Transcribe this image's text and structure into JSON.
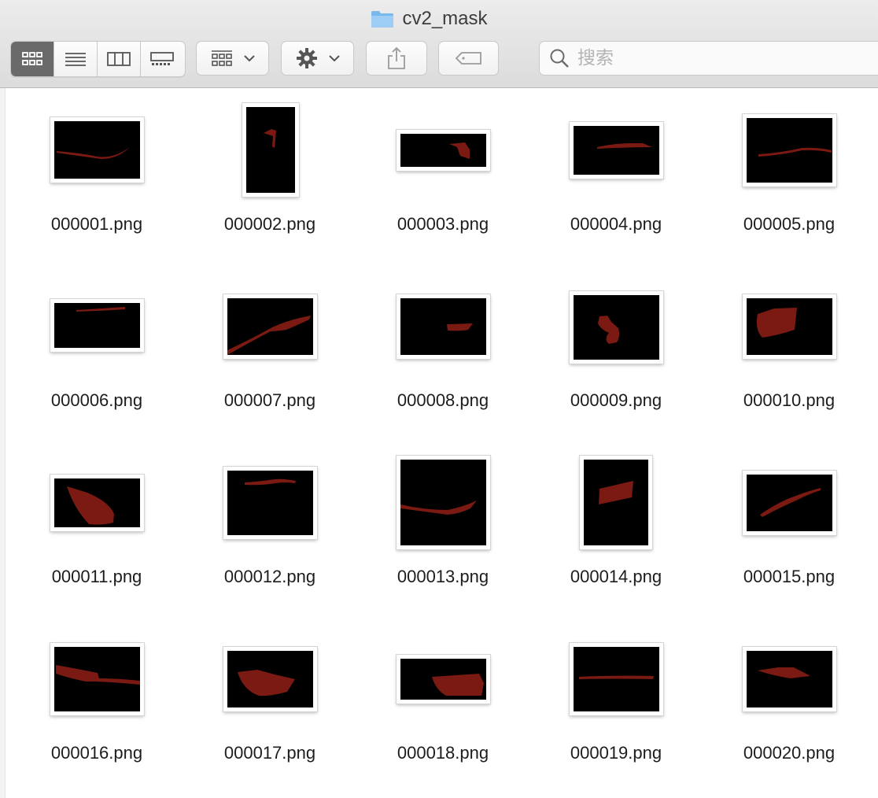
{
  "window": {
    "title": "cv2_mask"
  },
  "toolbar": {
    "view_modes": [
      "icon-view",
      "list-view",
      "column-view",
      "gallery-view"
    ],
    "active_view": "icon-view",
    "search_placeholder": "搜索"
  },
  "colors": {
    "mask_red": "#7b1a12",
    "thumb_bg": "#000000"
  },
  "files": [
    {
      "name": "000001.png"
    },
    {
      "name": "000002.png"
    },
    {
      "name": "000003.png"
    },
    {
      "name": "000004.png"
    },
    {
      "name": "000005.png"
    },
    {
      "name": "000006.png"
    },
    {
      "name": "000007.png"
    },
    {
      "name": "000008.png"
    },
    {
      "name": "000009.png"
    },
    {
      "name": "000010.png"
    },
    {
      "name": "000011.png"
    },
    {
      "name": "000012.png"
    },
    {
      "name": "000013.png"
    },
    {
      "name": "000014.png"
    },
    {
      "name": "000015.png"
    },
    {
      "name": "000016.png"
    },
    {
      "name": "000017.png"
    },
    {
      "name": "000018.png"
    },
    {
      "name": "000019.png"
    },
    {
      "name": "000020.png"
    }
  ]
}
